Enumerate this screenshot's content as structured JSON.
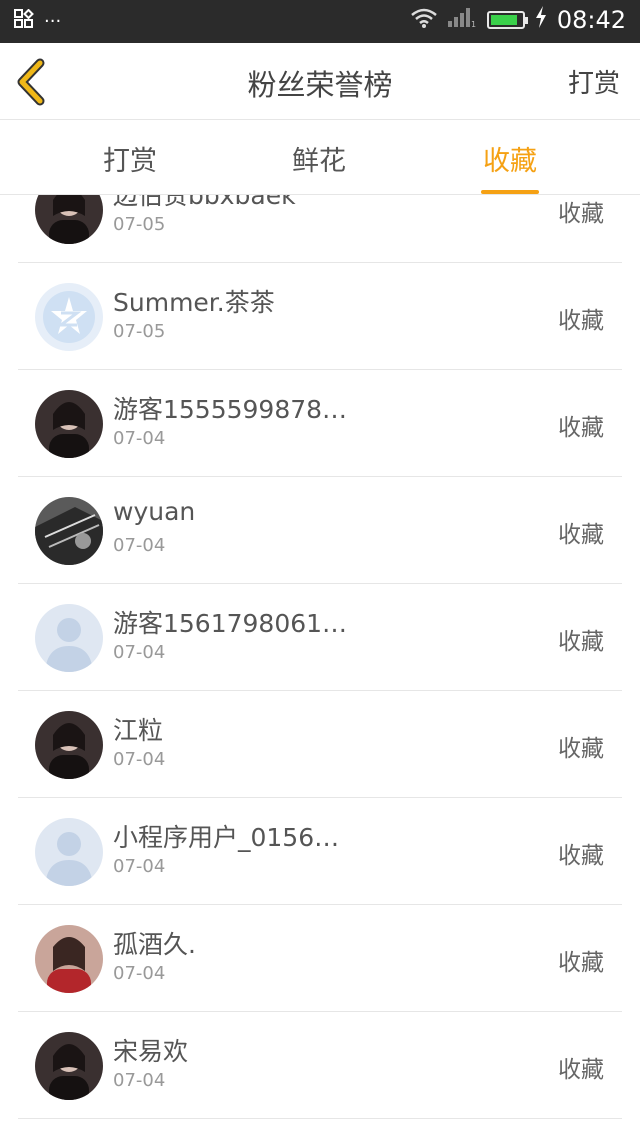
{
  "status_bar": {
    "time": "08:42",
    "notification_glyph": "···"
  },
  "nav": {
    "title": "粉丝荣誉榜",
    "action_label": "打赏"
  },
  "tabs": [
    {
      "label": "打赏",
      "active": false
    },
    {
      "label": "鲜花",
      "active": false
    },
    {
      "label": "收藏",
      "active": true
    }
  ],
  "colors": {
    "accent": "#f5a114",
    "statusbar_bg": "#2b2b2b",
    "divider": "#e6e6e6"
  },
  "items": [
    {
      "name": "边伯贤bbxbaek",
      "date": "07-05",
      "action": "收藏",
      "avatar": "photo-dark"
    },
    {
      "name": "Summer.茶茶",
      "date": "07-05",
      "action": "收藏",
      "avatar": "qq-logo"
    },
    {
      "name": "游客1555599878…",
      "date": "07-04",
      "action": "收藏",
      "avatar": "photo-dark"
    },
    {
      "name": "wyuan",
      "date": "07-04",
      "action": "收藏",
      "avatar": "photo-bw"
    },
    {
      "name": "游客1561798061…",
      "date": "07-04",
      "action": "收藏",
      "avatar": "default-user"
    },
    {
      "name": "江粒",
      "date": "07-04",
      "action": "收藏",
      "avatar": "photo-dark"
    },
    {
      "name": "小程序用户_0156…",
      "date": "07-04",
      "action": "收藏",
      "avatar": "default-user"
    },
    {
      "name": "孤酒久.",
      "date": "07-04",
      "action": "收藏",
      "avatar": "photo-warm"
    },
    {
      "name": "宋易欢",
      "date": "07-04",
      "action": "收藏",
      "avatar": "photo-dark"
    }
  ]
}
